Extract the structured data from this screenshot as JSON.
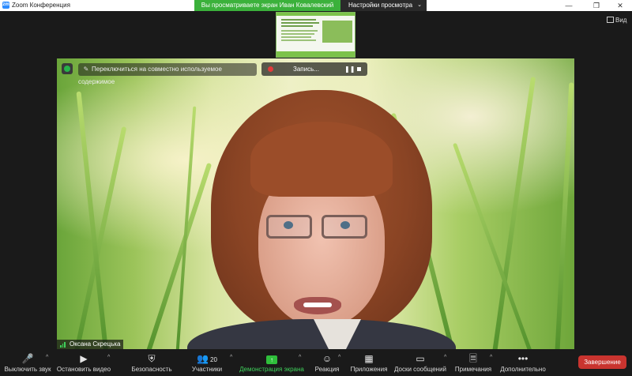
{
  "window": {
    "title": "Zoom Конференция",
    "app_icon": "zm",
    "controls": [
      "minimize-icon",
      "restore-icon",
      "close-icon"
    ]
  },
  "share_banner": {
    "text": "Вы просматриваете экран Иван Ковалевский",
    "view_options_label": "Настройки просмотра"
  },
  "view_button": {
    "label": "Вид"
  },
  "video": {
    "annotation_bar_text": "Переключиться на совместно используемое содержимое",
    "recording_label": "Запись...",
    "pause_symbol": "❚❚",
    "participant_name": "Оксана Скрецька"
  },
  "toolbar": {
    "mute_label": "Выключить звук",
    "video_label": "Остановить видео",
    "security_label": "Безопасность",
    "participants_label": "Участники",
    "participants_count": "20",
    "share_label": "Демонстрация экрана",
    "reactions_label": "Реакция",
    "apps_label": "Приложения",
    "whiteboards_label": "Доски сообщений",
    "notes_label": "Примечания",
    "more_label": "Дополнительно",
    "end_label": "Завершение"
  },
  "colors": {
    "share_banner": "#3bb13b",
    "end_button": "#c9342f",
    "share_icon": "#2fbf3b",
    "toolbar_bg": "#1a1a1a"
  }
}
